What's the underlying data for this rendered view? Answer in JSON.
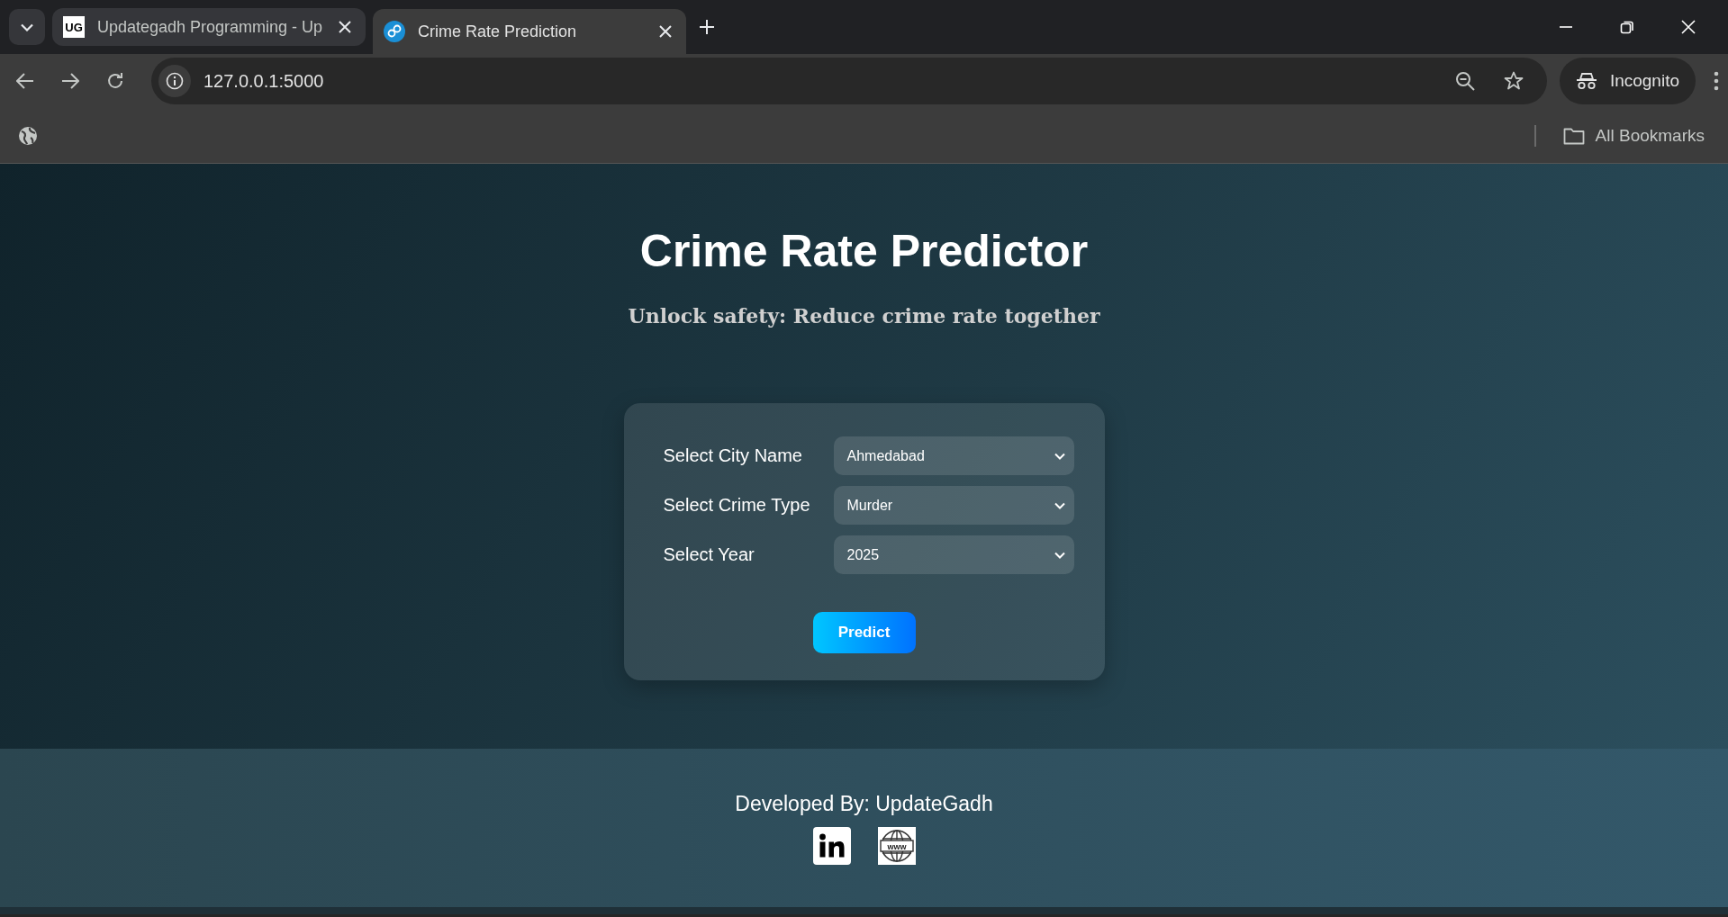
{
  "browser": {
    "tabs": [
      {
        "title": "Updategadh Programming - Up",
        "favicon": "UG",
        "selected": false
      },
      {
        "title": "Crime Rate Prediction",
        "selected": true
      }
    ],
    "address": "127.0.0.1:5000",
    "profile": "Incognito",
    "bookmarks": "All Bookmarks"
  },
  "page": {
    "title": "Crime Rate Predictor",
    "subtitle": "Unlock safety: Reduce crime rate together",
    "form": {
      "fields": [
        {
          "label": "Select City Name",
          "value": "Ahmedabad"
        },
        {
          "label": "Select Crime Type",
          "value": "Murder"
        },
        {
          "label": "Select Year",
          "value": "2025"
        }
      ],
      "button": "Predict"
    },
    "footer": {
      "credit": "Developed By: UpdateGadh",
      "web_icon_text": "www"
    }
  }
}
